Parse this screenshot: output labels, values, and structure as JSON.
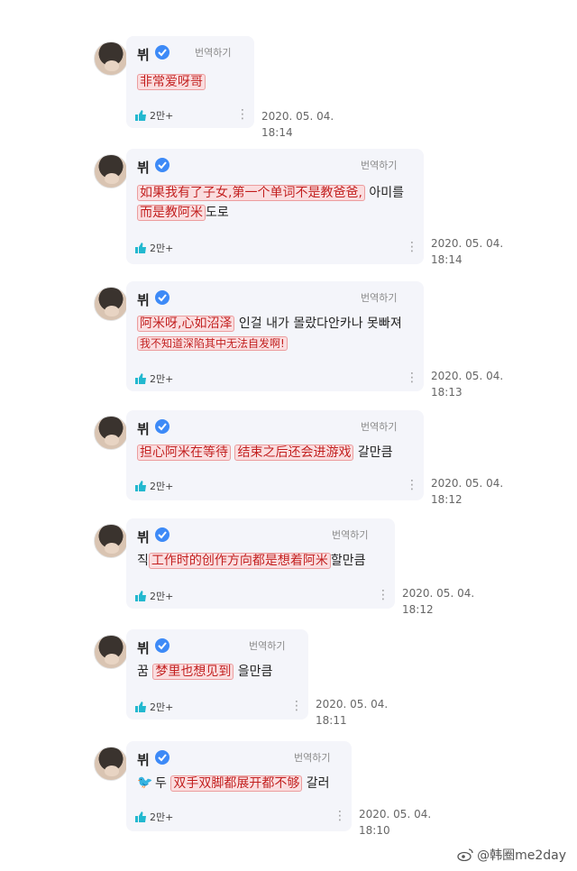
{
  "translate_label": "번역하기",
  "posts": [
    {
      "author": "뷔",
      "segments": [
        {
          "t": "非常爱呀哥",
          "hl": true
        }
      ],
      "likes": "2만+",
      "timestamp": "2020. 05. 04.\n18:14"
    },
    {
      "author": "뷔",
      "line1": [
        {
          "t": "如果我有了子女,第一个单词不是教爸爸,",
          "hl": true
        },
        {
          "t": " 아미를",
          "hl": false
        }
      ],
      "line2": [
        {
          "t": "而是教阿米",
          "hl": true
        },
        {
          "t": "도로",
          "hl": false
        }
      ],
      "likes": "2만+",
      "timestamp": "2020. 05. 04.\n18:14"
    },
    {
      "author": "뷔",
      "line1": [
        {
          "t": "阿米呀,心如沼泽",
          "hl": true
        },
        {
          "t": " 인걸 내가 몰랐다안카나 못빠져",
          "hl": false
        }
      ],
      "line2": [
        {
          "t": "我不知道深陷其中无法自发啊!",
          "hl": true
        }
      ],
      "likes": "2만+",
      "timestamp": "2020. 05. 04.\n18:13"
    },
    {
      "author": "뷔",
      "segments": [
        {
          "t": "担心阿米在等待",
          "hl": true
        },
        {
          "t": " ",
          "hl": false
        },
        {
          "t": "结束之后还会进游戏",
          "hl": true
        },
        {
          "t": " 갈만큼",
          "hl": false
        }
      ],
      "likes": "2만+",
      "timestamp": "2020. 05. 04.\n18:12"
    },
    {
      "author": "뷔",
      "segments": [
        {
          "t": "직",
          "hl": false
        },
        {
          "t": "工作时的创作方向都是想着阿米",
          "hl": true
        },
        {
          "t": "할만큼",
          "hl": false
        }
      ],
      "likes": "2만+",
      "timestamp": "2020. 05. 04.\n18:12"
    },
    {
      "author": "뷔",
      "segments": [
        {
          "t": "꿈 ",
          "hl": false
        },
        {
          "t": "梦里也想见到",
          "hl": true
        },
        {
          "t": " 을만큼",
          "hl": false
        }
      ],
      "likes": "2만+",
      "timestamp": "2020. 05. 04.\n18:11"
    },
    {
      "author": "뷔",
      "segments": [
        {
          "t": "두 ",
          "hl": false
        },
        {
          "t": "双手双脚都展开都不够",
          "hl": true
        },
        {
          "t": " 갈러",
          "hl": false
        }
      ],
      "likes": "2만+",
      "timestamp": "2020. 05. 04.\n18:10"
    }
  ],
  "watermark": "@韩圈me2day",
  "colors": {
    "accent": "#22b8cf",
    "verified": "#3d8af7",
    "card": "#f4f5fa",
    "highlight": "#c21b1b"
  },
  "icons": {
    "verified": "verified-check-icon",
    "like": "thumbs-up-icon",
    "more": "more-vertical-icon",
    "weibo": "weibo-logo-icon"
  }
}
